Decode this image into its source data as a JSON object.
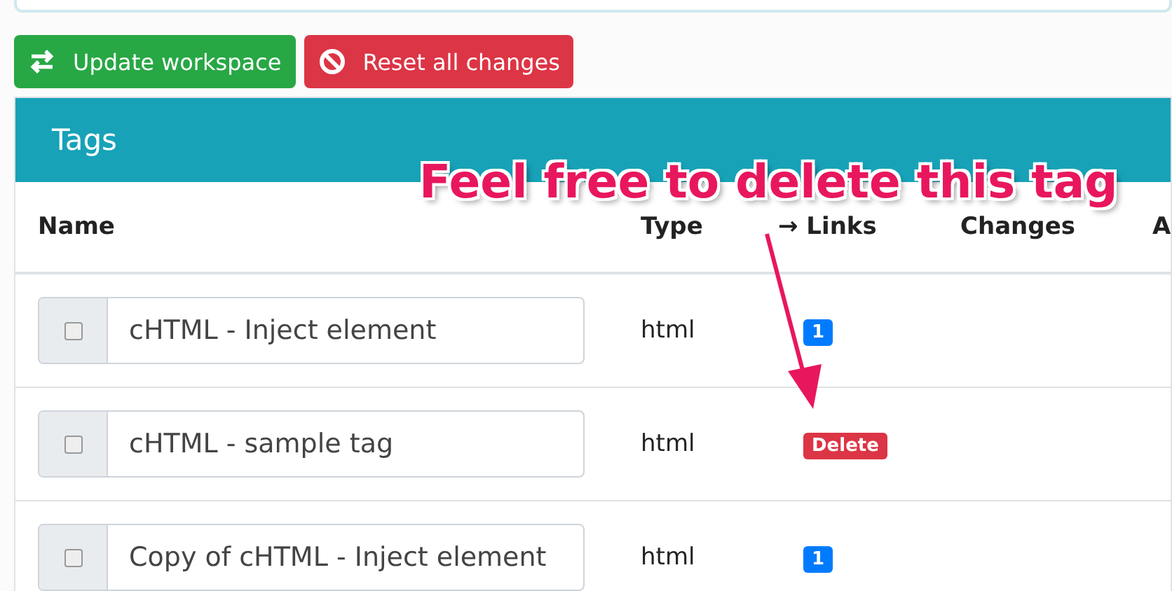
{
  "toolbar": {
    "buttons": [
      {
        "label": "Update workspace",
        "kind": "update"
      },
      {
        "label": "Reset all changes",
        "kind": "reset"
      }
    ]
  },
  "card": {
    "title": "Tags"
  },
  "table": {
    "columns": [
      "Name",
      "Type",
      "→ Links",
      "Changes",
      "A"
    ],
    "rows": [
      {
        "checked": false,
        "name": "cHTML - Inject element",
        "type": "html",
        "links": {
          "kind": "count",
          "text": "1"
        }
      },
      {
        "checked": false,
        "name": "cHTML - sample tag",
        "type": "html",
        "links": {
          "kind": "delete",
          "text": "Delete"
        }
      },
      {
        "checked": false,
        "name": "Copy of cHTML - Inject element",
        "type": "html",
        "links": {
          "kind": "count",
          "text": "1"
        }
      }
    ]
  },
  "annotation": {
    "text": "Feel free to delete this tag"
  }
}
